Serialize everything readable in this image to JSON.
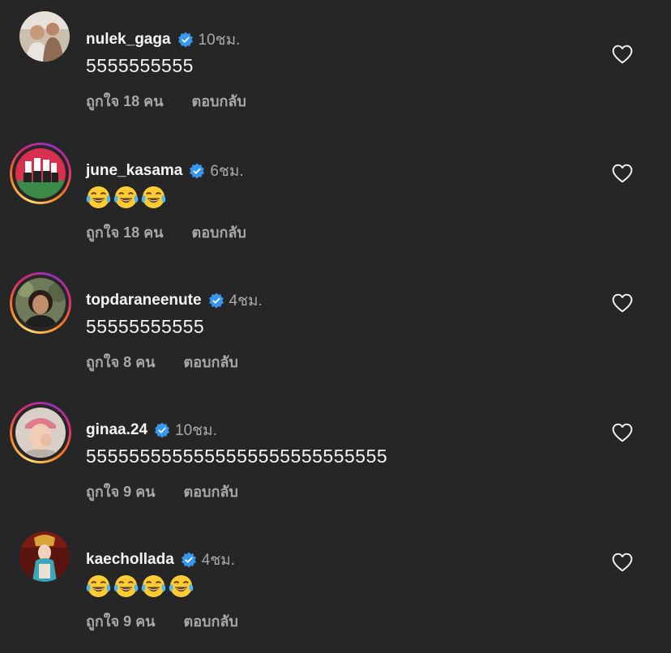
{
  "comments": [
    {
      "username": "nulek_gaga",
      "time": "10ชม.",
      "text": "5555555555",
      "emoji_count": 0,
      "likes": "ถูกใจ 18 คน",
      "reply": "ตอบกลับ",
      "verified": true,
      "story_ring": false
    },
    {
      "username": "june_kasama",
      "time": "6ชม.",
      "text": "",
      "emoji_count": 3,
      "likes": "ถูกใจ 18 คน",
      "reply": "ตอบกลับ",
      "verified": true,
      "story_ring": true
    },
    {
      "username": "topdaraneenute",
      "time": "4ชม.",
      "text": "55555555555",
      "emoji_count": 0,
      "likes": "ถูกใจ 8 คน",
      "reply": "ตอบกลับ",
      "verified": true,
      "story_ring": true
    },
    {
      "username": "ginaa.24",
      "time": "10ชม.",
      "text": "5555555555555555555555555555",
      "emoji_count": 0,
      "likes": "ถูกใจ 9 คน",
      "reply": "ตอบกลับ",
      "verified": true,
      "story_ring": true
    },
    {
      "username": "kaechollada",
      "time": "4ชม.",
      "text": "",
      "emoji_count": 4,
      "likes": "ถูกใจ 9 คน",
      "reply": "ตอบกลับ",
      "verified": true,
      "story_ring": false
    }
  ],
  "icons": {
    "verified": "verified-badge-icon",
    "like": "heart-outline-icon",
    "emoji": "face-with-tears-of-joy"
  },
  "colors": {
    "background": "#262626",
    "primary_text": "#f5f5f5",
    "secondary_text": "#a8a8a8",
    "verified_blue": "#3897f0"
  }
}
